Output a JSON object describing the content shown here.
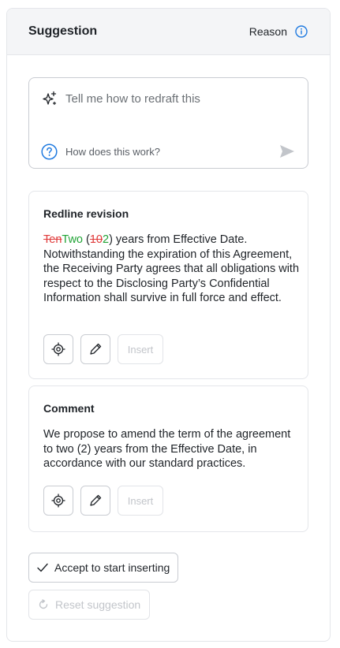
{
  "header": {
    "title": "Suggestion",
    "reason_label": "Reason"
  },
  "prompt": {
    "placeholder": "Tell me how to redraft this",
    "help_label": "How does this work?"
  },
  "redline": {
    "title": "Redline revision",
    "deleted_word": "Ten",
    "inserted_word": "Two",
    "paren_open": " (",
    "deleted_num": "10",
    "inserted_num": "2",
    "rest": ") years from Effective Date. Notwithstanding the expiration of this Agreement, the Receiving Party agrees that all obligations with respect to the Disclosing Party’s Confidential Information shall survive in full force and effect.",
    "insert_label": "Insert"
  },
  "comment": {
    "title": "Comment",
    "text": "We propose to amend the term of the agreement to two (2) years from the Effective Date, in accordance with our standard practices.",
    "insert_label": "Insert"
  },
  "actions": {
    "accept_label": "Accept to start inserting",
    "reset_label": "Reset suggestion"
  },
  "colors": {
    "accent": "#1f7ae0",
    "deleted": "#e03b3b",
    "inserted": "#21a336"
  }
}
